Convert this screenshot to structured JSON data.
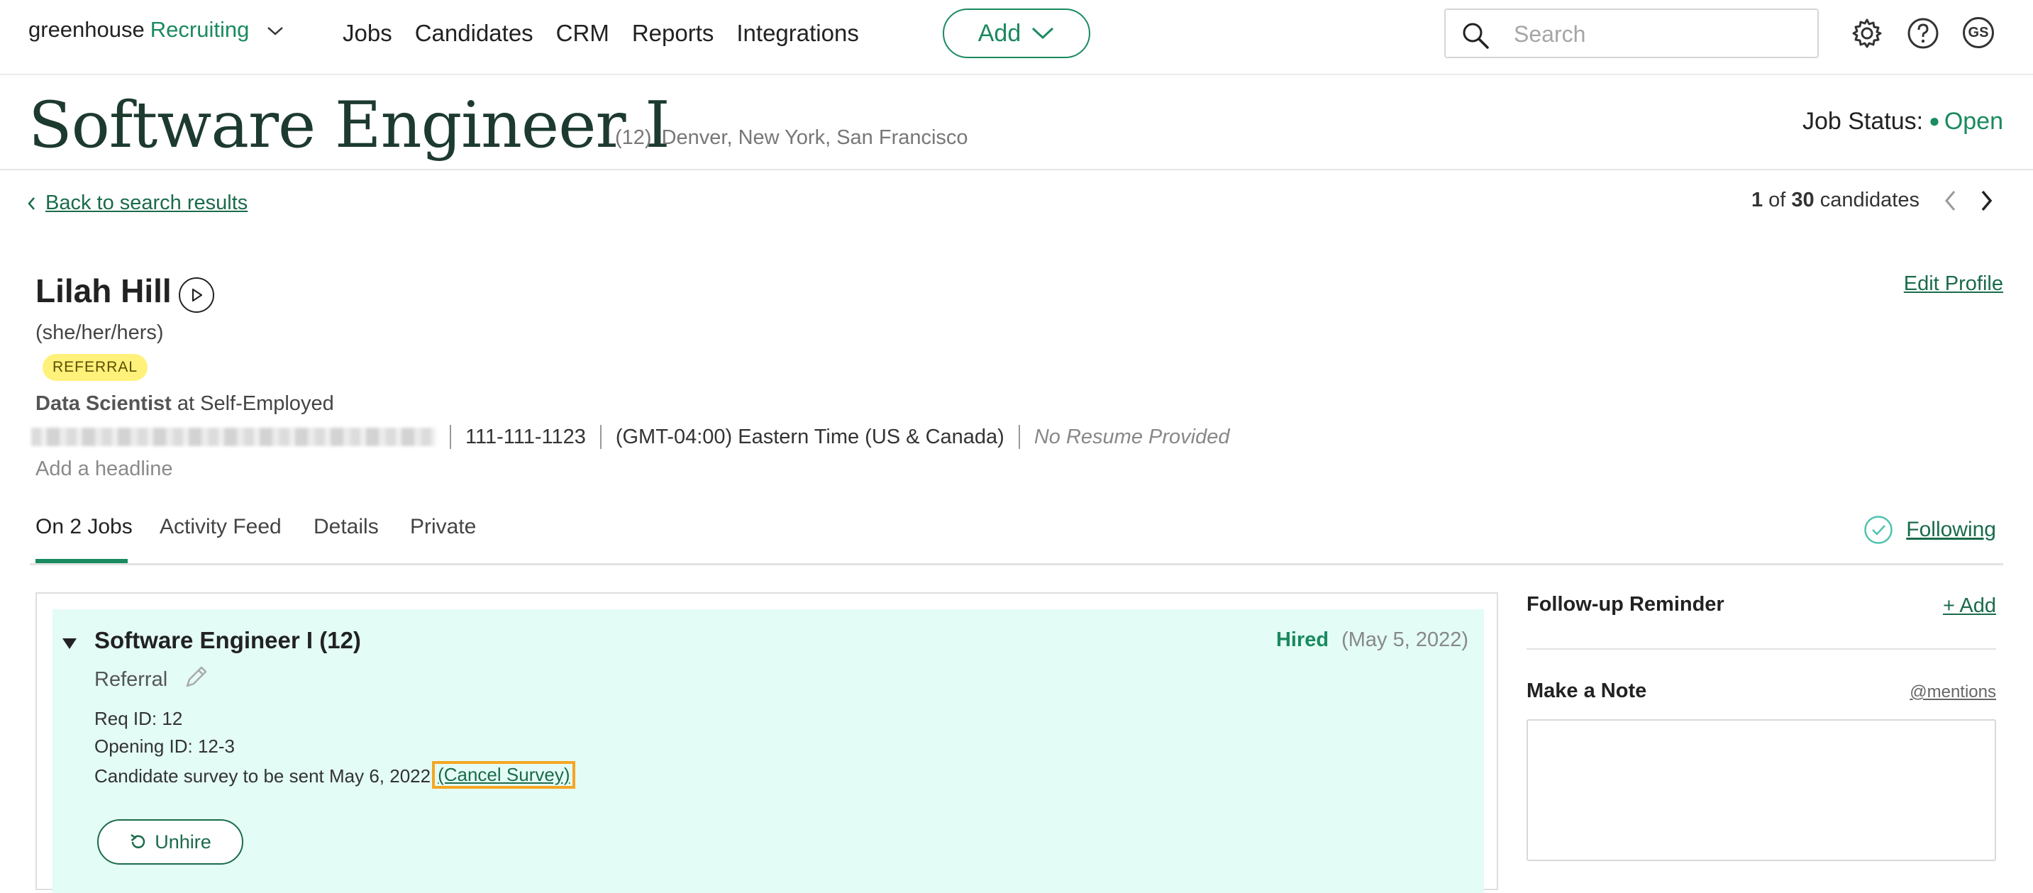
{
  "app": {
    "logo_main": "greenhouse",
    "logo_product": "Recruiting",
    "nav": [
      "Jobs",
      "Candidates",
      "CRM",
      "Reports",
      "Integrations"
    ],
    "add_label": "Add",
    "search_placeholder": "Search",
    "avatar_initials": "GS"
  },
  "job": {
    "title": "Software Engineer I",
    "count": "(12)",
    "locations": "Denver, New York, San Francisco",
    "status_label": "Job Status:",
    "status_value": "Open",
    "accent_color": "#1a8a5f"
  },
  "navigation": {
    "back_label": "Back to search results",
    "pager_current": "1",
    "pager_of": "of",
    "pager_total": "30",
    "pager_suffix": "candidates"
  },
  "candidate": {
    "name": "Lilah Hill",
    "pronouns": "(she/her/hers)",
    "badge": "REFERRAL",
    "title": "Data Scientist",
    "at": "at",
    "company": "Self-Employed",
    "phone": "111-111-1123",
    "timezone": "(GMT-04:00) Eastern Time (US & Canada)",
    "resume": "No Resume Provided",
    "headline_placeholder": "Add a headline",
    "edit_profile": "Edit Profile"
  },
  "tabs": {
    "items": [
      "On 2 Jobs",
      "Activity Feed",
      "Details",
      "Private"
    ],
    "active": "On 2 Jobs",
    "following": "Following"
  },
  "application": {
    "title": "Software Engineer I (12)",
    "status": "Hired",
    "status_date": "(May 5, 2022)",
    "source": "Referral",
    "req_id": "Req ID: 12",
    "opening_id": "Opening ID: 12-3",
    "survey_text": "Candidate survey to be sent May 6, 2022",
    "cancel_survey": "(Cancel Survey)",
    "unhire": "Unhire"
  },
  "sidebar": {
    "followup_title": "Follow-up Reminder",
    "followup_add": "+ Add",
    "note_title": "Make a Note",
    "mentions": "@mentions"
  }
}
